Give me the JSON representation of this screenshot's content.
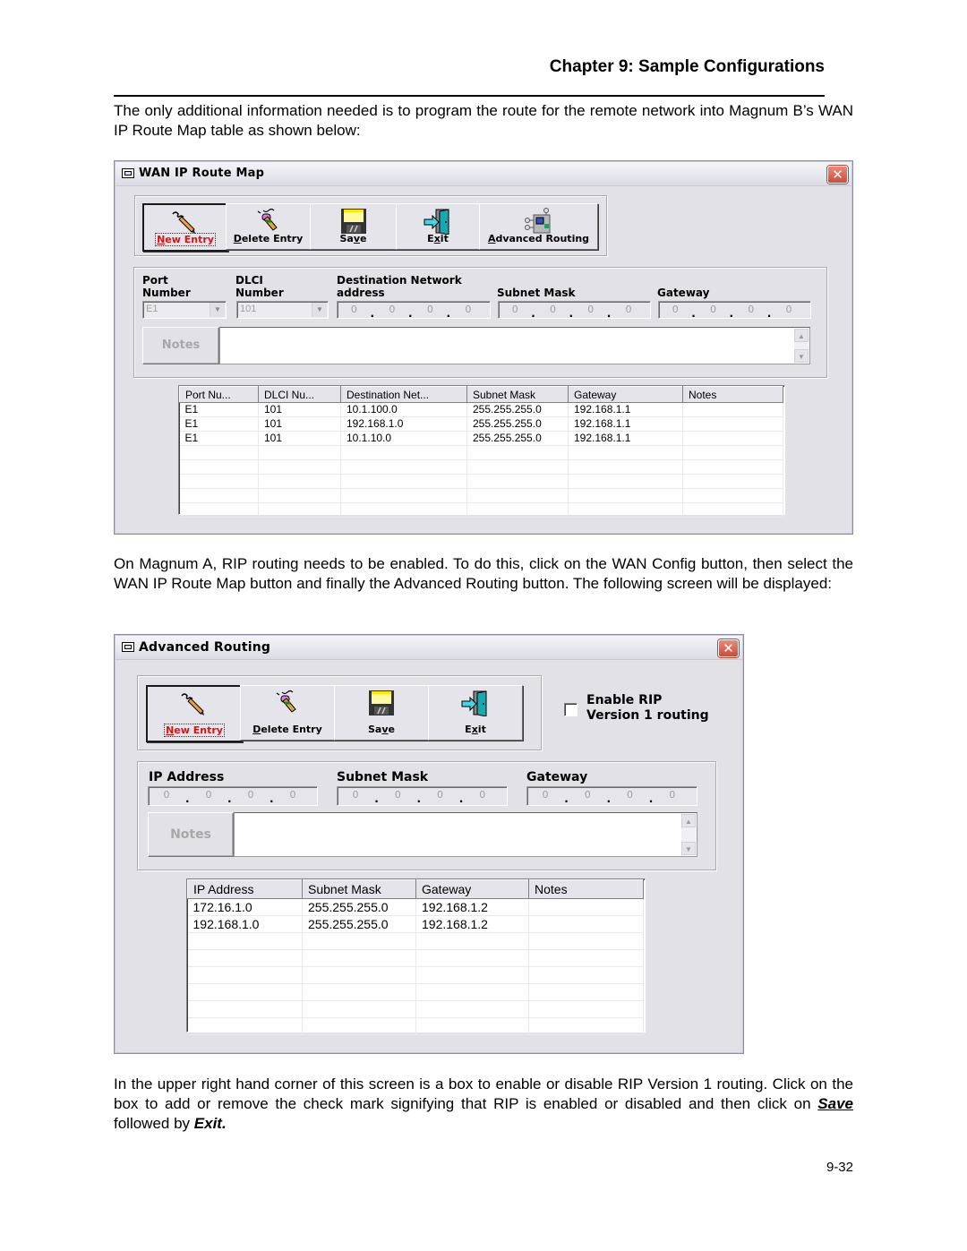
{
  "header": {
    "chapter_title": "Chapter 9: Sample Configurations"
  },
  "paragraphs": {
    "intro": "The only additional information needed is to program the route for the remote network into Magnum B’s WAN IP Route Map table as shown below:",
    "rip_intro": "On Magnum A, RIP routing needs to be enabled.  To do this, click on the WAN Config button, then select the WAN IP Route Map button and finally the Advanced Routing button.  The following screen will be displayed:",
    "closing_prefix": "In the upper right hand corner of this screen is a box to enable or disable RIP Version 1 routing. Click on the box to add or remove the check mark signifying that RIP is enabled or disabled and then click on ",
    "closing_save": "Save",
    "closing_middle": " followed by ",
    "closing_exit": "Exit."
  },
  "page_number": "9-32",
  "wan_route_map": {
    "title": "WAN IP Route Map",
    "close_icon": "close-icon",
    "toolbar": [
      {
        "label": "New Entry",
        "icon": "pen-icon"
      },
      {
        "label": "Delete Entry",
        "icon": "eraser-pencil-icon"
      },
      {
        "label": "Save",
        "icon": "floppy-disk-icon"
      },
      {
        "label": "Exit",
        "icon": "exit-door-icon"
      },
      {
        "label": "Advanced Routing",
        "icon": "network-routing-icon"
      }
    ],
    "fields": {
      "port_label_1": "Port",
      "port_label_2": "Number",
      "port_value": "E1",
      "dlci_label_1": "DLCI",
      "dlci_label_2": "Number",
      "dlci_value": "101",
      "dest_label_1": "Destination Network",
      "dest_label_2": "address",
      "dest_value": [
        "0",
        "0",
        "0",
        "0"
      ],
      "subnet_label": "Subnet Mask",
      "subnet_value": [
        "0",
        "0",
        "0",
        "0"
      ],
      "gateway_label": "Gateway",
      "gateway_value": [
        "0",
        "0",
        "0",
        "0"
      ],
      "notes_label": "Notes",
      "notes_value": ""
    },
    "table": {
      "columns": [
        "Port Nu...",
        "DLCI Nu...",
        "Destination Net...",
        "Subnet Mask",
        "Gateway",
        "Notes"
      ],
      "rows": [
        [
          "E1",
          "101",
          "10.1.100.0",
          "255.255.255.0",
          "192.168.1.1",
          ""
        ],
        [
          "E1",
          "101",
          "192.168.1.0",
          "255.255.255.0",
          "192.168.1.1",
          ""
        ],
        [
          "E1",
          "101",
          "10.1.10.0",
          "255.255.255.0",
          "192.168.1.1",
          ""
        ]
      ],
      "empty_rows": 5
    }
  },
  "advanced_routing": {
    "title": "Advanced Routing",
    "toolbar": [
      {
        "label": "New Entry",
        "icon": "pen-icon"
      },
      {
        "label": "Delete Entry",
        "icon": "eraser-pencil-icon"
      },
      {
        "label": "Save",
        "icon": "floppy-disk-icon"
      },
      {
        "label": "Exit",
        "icon": "exit-door-icon"
      }
    ],
    "rip_checkbox": {
      "label_1": "Enable RIP",
      "label_2": "Version 1 routing",
      "checked": false
    },
    "fields": {
      "ip_label": "IP Address",
      "ip_value": [
        "0",
        "0",
        "0",
        "0"
      ],
      "subnet_label": "Subnet Mask",
      "subnet_value": [
        "0",
        "0",
        "0",
        "0"
      ],
      "gateway_label": "Gateway",
      "gateway_value": [
        "0",
        "0",
        "0",
        "0"
      ],
      "notes_label": "Notes",
      "notes_value": ""
    },
    "table": {
      "columns": [
        "IP Address",
        "Subnet Mask",
        "Gateway",
        "Notes"
      ],
      "rows": [
        [
          "172.16.1.0",
          "255.255.255.0",
          "192.168.1.2",
          ""
        ],
        [
          "192.168.1.0",
          "255.255.255.0",
          "192.168.1.2",
          ""
        ]
      ],
      "empty_rows": 6
    }
  }
}
